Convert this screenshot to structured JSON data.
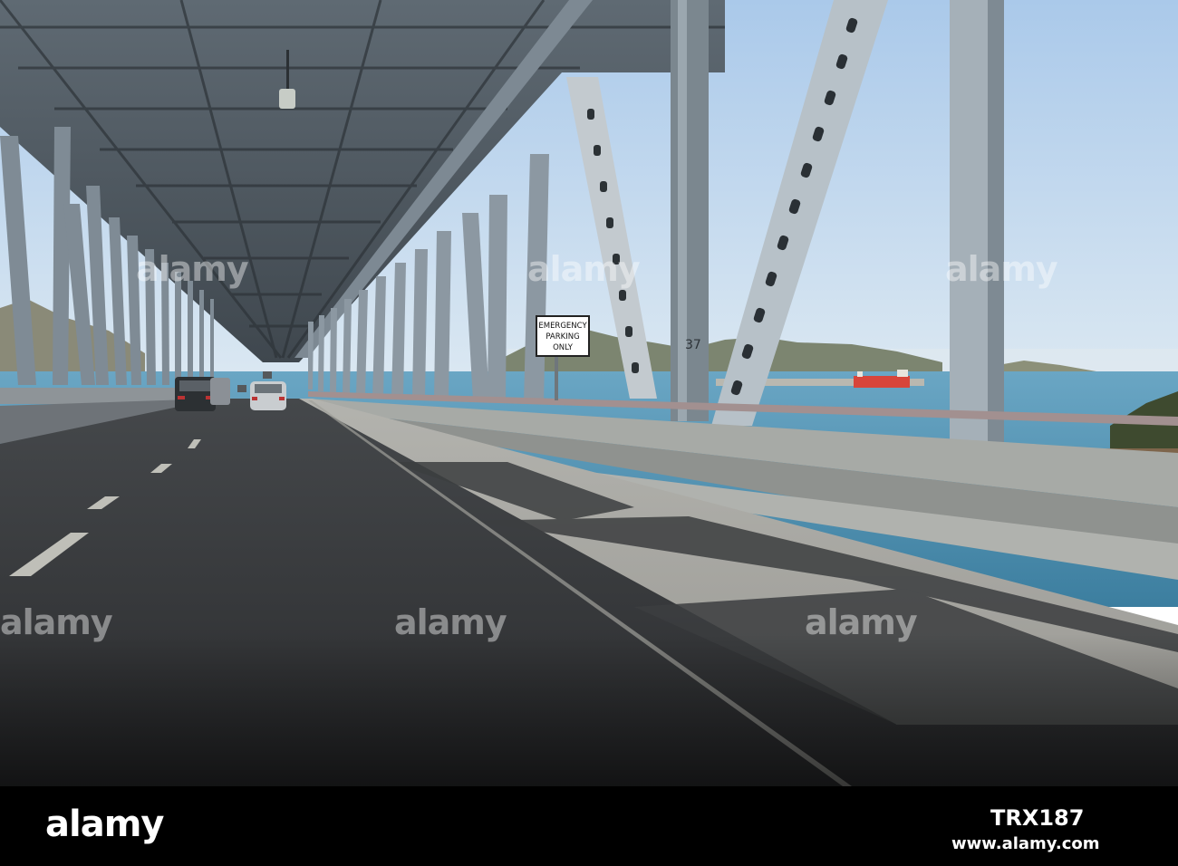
{
  "photo": {
    "sign": {
      "line1": "EMERGENCY",
      "line2": "PARKING",
      "line3": "ONLY"
    },
    "truss_marking": "37"
  },
  "watermark": {
    "text": "alamy"
  },
  "footer": {
    "logo": "alamy",
    "image_id": "TRX187",
    "url": "www.alamy.com"
  },
  "colors": {
    "sky": "#c9dff2",
    "water": "#5a97b5",
    "steel": "#9aa6b0",
    "road": "#383a3c",
    "ship_hull": "#d8453a"
  }
}
